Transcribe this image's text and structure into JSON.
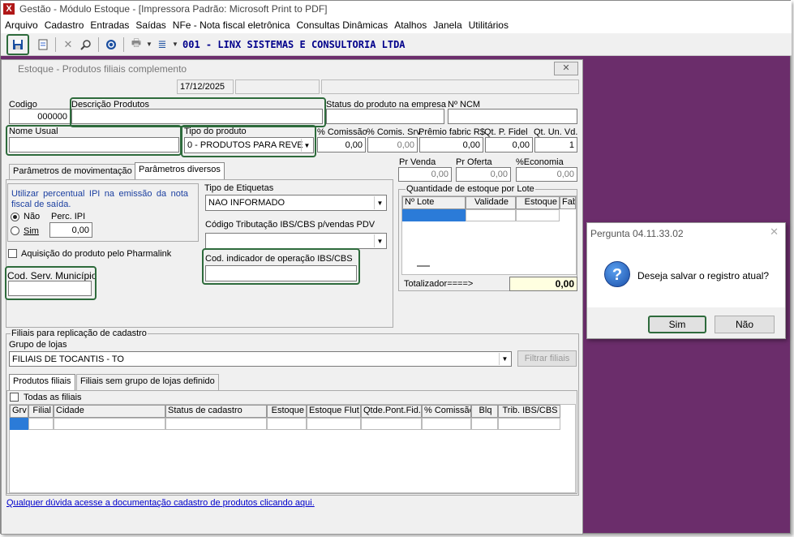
{
  "app": {
    "title": "Gestão   - Módulo Estoque - [Impressora Padrão: Microsoft Print to PDF]"
  },
  "menu": [
    "Arquivo",
    "Cadastro",
    "Entradas",
    "Saídas",
    "NFe - Nota fiscal eletrônica",
    "Consultas Dinâmicas",
    "Atalhos",
    "Janela",
    "Utilitários"
  ],
  "toolbar": {
    "company": "001 - LINX SISTEMAS E CONSULTORIA LTDA"
  },
  "window": {
    "title": "Estoque - Produtos filiais complemento",
    "close": "✕",
    "date": "17/12/2025"
  },
  "fields": {
    "codigo_label": "Codigo",
    "codigo_value": "000000",
    "descricao_label": "Descrição  Produtos",
    "status_label": "Status do produto na empresa",
    "ncm_label": "Nº NCM",
    "nome_usual_label": "Nome Usual",
    "tipo_label": "Tipo do produto",
    "tipo_value": "0 - PRODUTOS PARA REVE",
    "comissao_label": "% Comissão",
    "comissao_value": "0,00",
    "comis_srv_label": "% Comis. Srv.",
    "comis_srv_value": "0,00",
    "premio_label": "Prêmio fabric R$",
    "premio_value": "0,00",
    "qt_fidel_label": "Qt. P. Fidel",
    "qt_fidel_value": "0,00",
    "qt_un_label": "Qt. Un. Vd.",
    "qt_un_value": "1",
    "pr_venda_label": "Pr Venda",
    "pr_venda_value": "0,00",
    "pr_oferta_label": "Pr Oferta",
    "pr_oferta_value": "0,00",
    "economia_label": "%Economia",
    "economia_value": "0,00"
  },
  "tabs": {
    "movimentacao": "Parâmetros de movimentação",
    "diversos": "Parâmetros diversos"
  },
  "diversos": {
    "ipi_text": "Utilizar  percentual  IPI  na emissão  da  nota fiscal de saída.",
    "nao": "Não",
    "sim": "Sim",
    "perc_ipi_label": "Perc. IPI",
    "perc_ipi_value": "0,00",
    "pharmalink": "Aquisição do produto pelo Pharmalink",
    "cod_serv_label": "Cod. Serv. Município",
    "etiquetas_label": "Tipo de Etiquetas",
    "etiquetas_value": "NAO INFORMADO",
    "trib_label": "Código Tributação IBS/CBS p/vendas PDV",
    "cod_ind_label": "Cod. indicador de operação IBS/CBS"
  },
  "lote": {
    "title": "Quantidade de estoque por Lote",
    "columns": [
      "Nº Lote",
      "Validade",
      "Estoque",
      "Fab"
    ],
    "totalizador_label": "Totalizador====>",
    "totalizador_value": "0,00"
  },
  "filiais": {
    "title": "Filiais para replicação de cadastro",
    "grupo_label": "Grupo de lojas",
    "grupo_value": "FILIAIS DE TOCANTIS - TO",
    "filtrar": "Filtrar filiais",
    "tab_produtos": "Produtos filiais",
    "tab_sem_grupo": "Filiais sem grupo de lojas definido",
    "todas": "Todas as filiais",
    "columns": [
      "Grv",
      "Filial",
      "Cidade",
      "Status de cadastro",
      "Estoque",
      "Estoque Flut",
      "Qtde.Pont.Fid.",
      "% Comissão",
      "Blq",
      "Trib. IBS/CBS"
    ]
  },
  "help_link": "Qualquer dúvida acesse a documentação cadastro de produtos clicando aqui.",
  "dialog": {
    "title": "Pergunta 04.11.33.02",
    "message": "Deseja salvar o registro atual?",
    "yes": "Sim",
    "no": "Não",
    "icon": "question-icon"
  }
}
